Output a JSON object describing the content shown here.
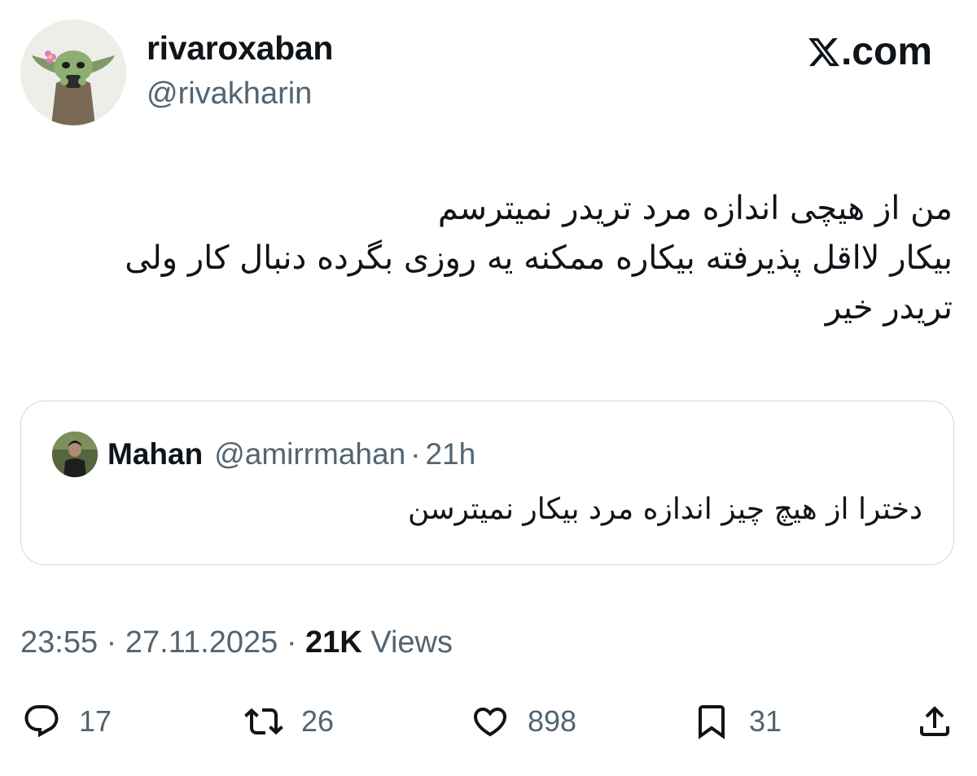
{
  "author": {
    "display_name": "rivaroxaban",
    "handle": "@rivakharin"
  },
  "brand": {
    "label": ".com",
    "icon": "x-logo-icon"
  },
  "tweet": {
    "lines": [
      "من از هیچی اندازه مرد تریدر نمیترسم",
      "بیکار لااقل پذیرفته بیکاره ممکنه یه روزی بگرده دنبال کار ولی",
      "تریدر خیر"
    ]
  },
  "quote": {
    "name": "Mahan",
    "handle": "@amirrmahan",
    "separator": "·",
    "time": "21h",
    "text": "دخترا از هیچ چیز اندازه مرد بیکار نمیترسن"
  },
  "meta": {
    "time": "23:55",
    "sep1": "·",
    "date": "27.11.2025",
    "sep2": "·",
    "views_count": "21K",
    "views_label": "Views"
  },
  "actions": {
    "replies": "17",
    "reposts": "26",
    "likes": "898",
    "bookmarks": "31"
  },
  "colors": {
    "text": "#0f1419",
    "secondary": "#536471",
    "border": "#cfd9de"
  }
}
